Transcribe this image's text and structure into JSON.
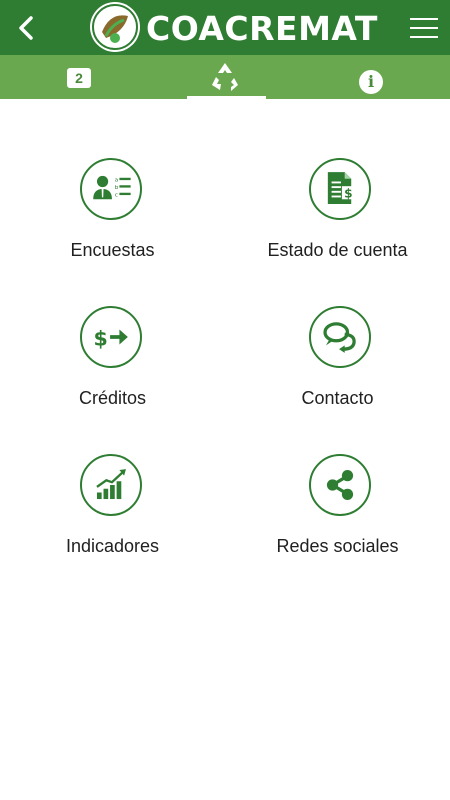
{
  "header": {
    "brand_name": "COACREMAT"
  },
  "tabs": {
    "badge_value": "2",
    "info_label": "i"
  },
  "menu": {
    "items": [
      {
        "label": "Encuestas",
        "icon": "survey-icon"
      },
      {
        "label": "Estado de cuenta",
        "icon": "account-statement-icon"
      },
      {
        "label": "Créditos",
        "icon": "credits-icon"
      },
      {
        "label": "Contacto",
        "icon": "chat-icon"
      },
      {
        "label": "Indicadores",
        "icon": "bar-chart-icon"
      },
      {
        "label": "Redes sociales",
        "icon": "share-icon"
      }
    ]
  },
  "colors": {
    "primary": "#2e7d32",
    "secondary": "#6aa84f",
    "text": "#212121"
  }
}
